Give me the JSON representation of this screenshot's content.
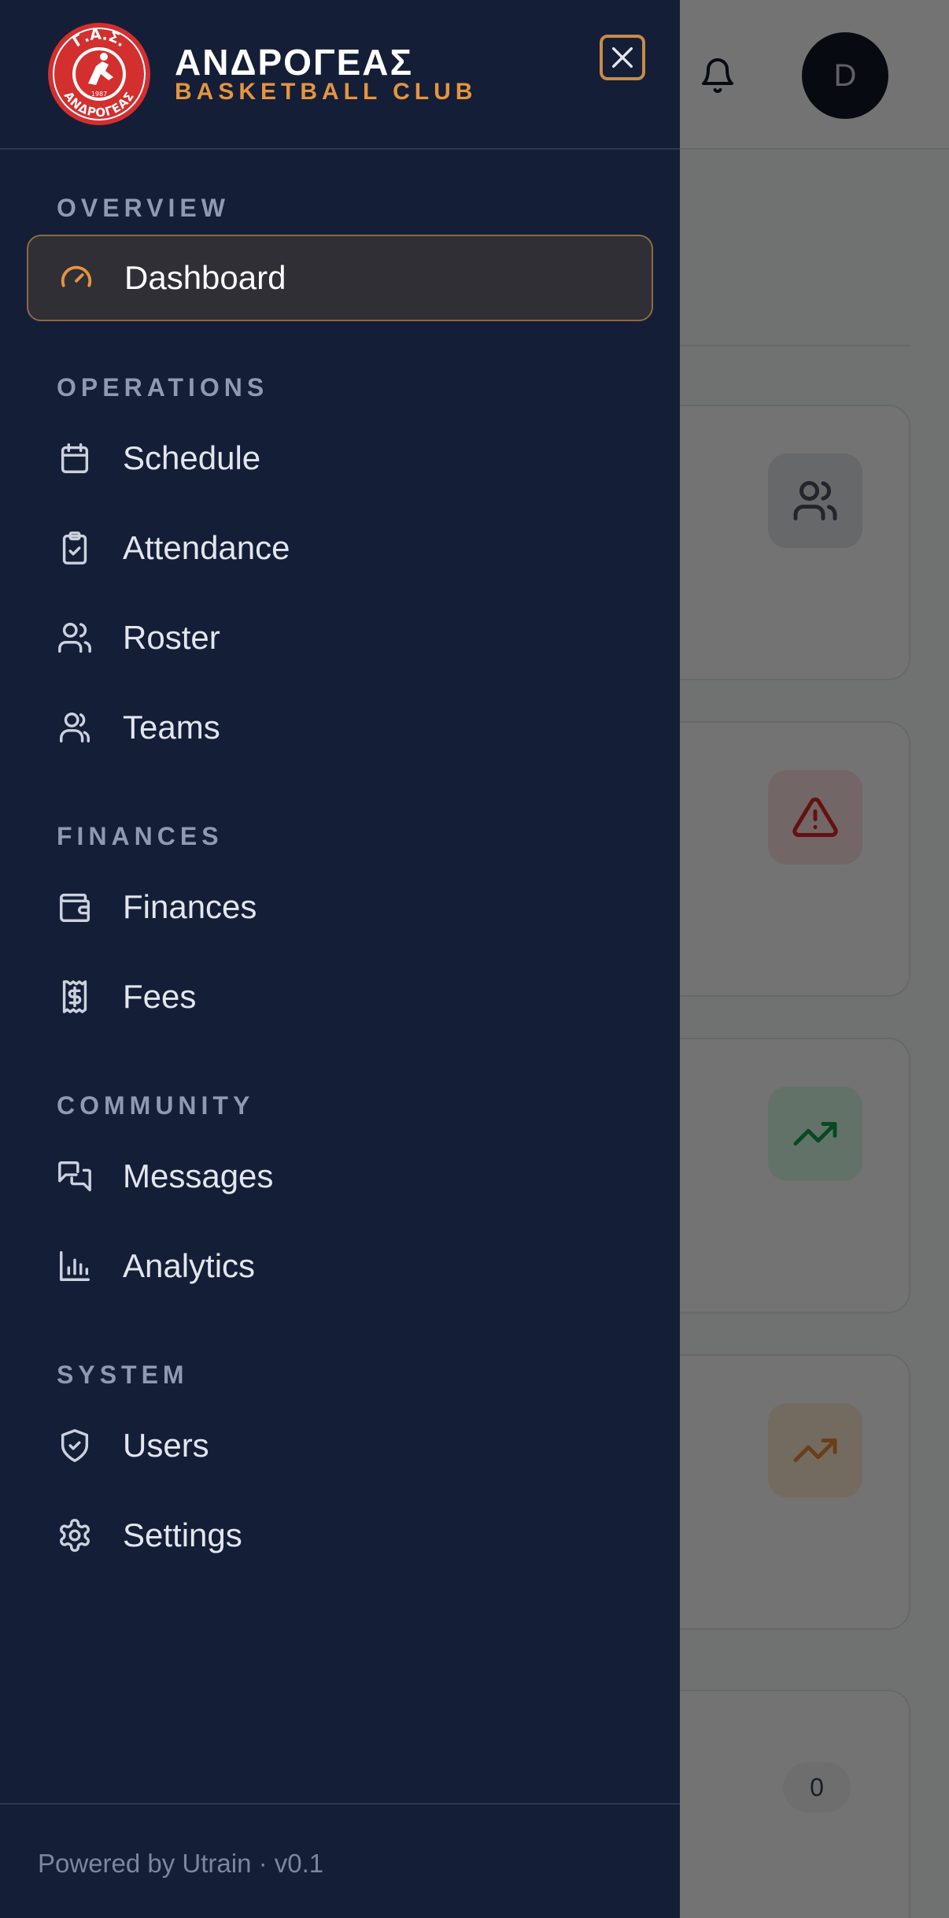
{
  "app": {
    "avatar_initial": "D",
    "card_count": "0",
    "stat_cards": [
      {
        "icon": "users-icon",
        "color": "#4b5563",
        "bg": "#e5e7eb"
      },
      {
        "icon": "alert-triangle-icon",
        "color": "#dc2626",
        "bg": "#fee2e2"
      },
      {
        "icon": "trending-up-icon",
        "color": "#16a34a",
        "bg": "#dcfce7"
      },
      {
        "icon": "trending-up-icon",
        "color": "#ea8a3a",
        "bg": "#ffedd5"
      }
    ]
  },
  "brand": {
    "logo_top_text": "Γ.Α.Σ.",
    "logo_year": "1987",
    "logo_bottom_text": "ΑΝΔΡΟΓΕΑΣ",
    "name": "ΑΝΔΡΟΓΕΑΣ",
    "subtitle": "BASKETBALL CLUB",
    "accent": "#e4953f",
    "logo_red": "#d32f2f"
  },
  "drawer": {
    "background": "#141e37",
    "sections": [
      {
        "title": "OVERVIEW",
        "items": [
          {
            "label": "Dashboard",
            "icon": "gauge-icon",
            "active": true
          }
        ]
      },
      {
        "title": "OPERATIONS",
        "items": [
          {
            "label": "Schedule",
            "icon": "calendar-icon"
          },
          {
            "label": "Attendance",
            "icon": "clipboard-check-icon"
          },
          {
            "label": "Roster",
            "icon": "users-icon"
          },
          {
            "label": "Teams",
            "icon": "user-group-icon"
          }
        ]
      },
      {
        "title": "FINANCES",
        "items": [
          {
            "label": "Finances",
            "icon": "wallet-icon"
          },
          {
            "label": "Fees",
            "icon": "receipt-icon"
          }
        ]
      },
      {
        "title": "COMMUNITY",
        "items": [
          {
            "label": "Messages",
            "icon": "messages-icon"
          },
          {
            "label": "Analytics",
            "icon": "bar-chart-icon"
          }
        ]
      },
      {
        "title": "SYSTEM",
        "items": [
          {
            "label": "Users",
            "icon": "shield-check-icon"
          },
          {
            "label": "Settings",
            "icon": "gear-icon"
          }
        ]
      }
    ],
    "footer": "Powered by Utrain · v0.1"
  }
}
